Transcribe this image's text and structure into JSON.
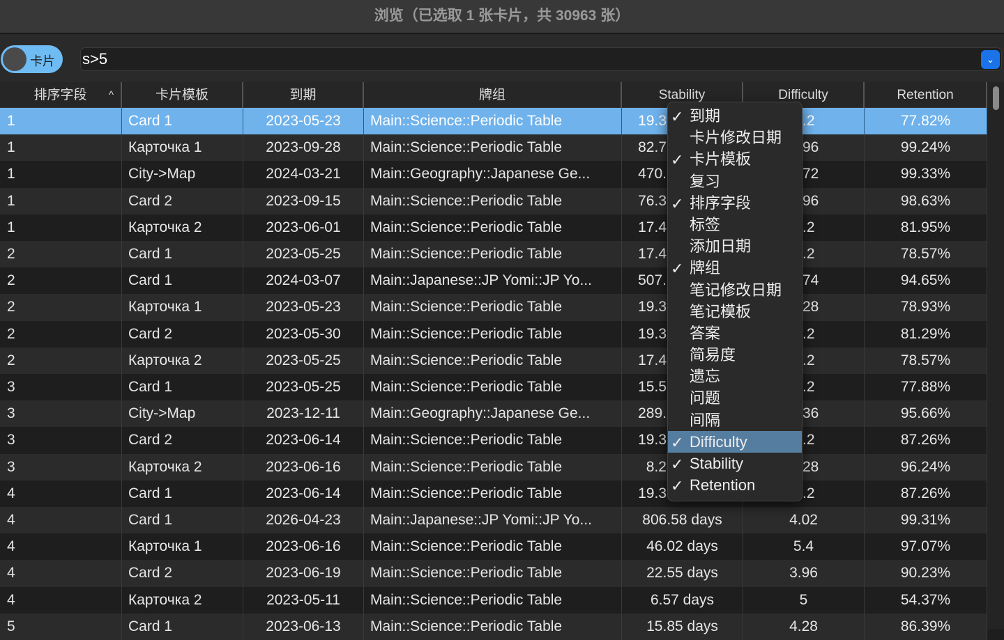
{
  "title": "浏览（已选取 1 张卡片，共 30963 张）",
  "toggle_label": "卡片",
  "search": {
    "value": "s>5"
  },
  "columns": [
    "排序字段",
    "卡片模板",
    "到期",
    "牌组",
    "Stability",
    "Difficulty",
    "Retention"
  ],
  "rows": [
    [
      "1",
      "Card 1",
      "2023-05-23",
      "Main::Science::Periodic Table",
      "19.3",
      ".2",
      "77.82%"
    ],
    [
      "1",
      "Карточка 1",
      "2023-09-28",
      "Main::Science::Periodic Table",
      "82.7",
      "96",
      "99.24%"
    ],
    [
      "1",
      "City->Map",
      "2024-03-21",
      "Main::Geography::Japanese Ge...",
      "470.",
      "72",
      "99.33%"
    ],
    [
      "1",
      "Card 2",
      "2023-09-15",
      "Main::Science::Periodic Table",
      "76.3",
      "96",
      "98.63%"
    ],
    [
      "1",
      "Карточка 2",
      "2023-06-01",
      "Main::Science::Periodic Table",
      "17.4",
      ".2",
      "81.95%"
    ],
    [
      "2",
      "Card 1",
      "2023-05-25",
      "Main::Science::Periodic Table",
      "17.4",
      ".2",
      "78.57%"
    ],
    [
      "2",
      "Card 1",
      "2024-03-07",
      "Main::Japanese::JP Yomi::JP Yo...",
      "507.",
      "74",
      "94.65%"
    ],
    [
      "2",
      "Карточка 1",
      "2023-05-23",
      "Main::Science::Periodic Table",
      "19.3",
      "28",
      "78.93%"
    ],
    [
      "2",
      "Card 2",
      "2023-05-30",
      "Main::Science::Periodic Table",
      "19.3",
      ".2",
      "81.29%"
    ],
    [
      "2",
      "Карточка 2",
      "2023-05-25",
      "Main::Science::Periodic Table",
      "17.4",
      ".2",
      "78.57%"
    ],
    [
      "3",
      "Card 1",
      "2023-05-25",
      "Main::Science::Periodic Table",
      "15.5",
      ".2",
      "77.88%"
    ],
    [
      "3",
      "City->Map",
      "2023-12-11",
      "Main::Geography::Japanese Ge...",
      "289.",
      "36",
      "95.66%"
    ],
    [
      "3",
      "Card 2",
      "2023-06-14",
      "Main::Science::Periodic Table",
      "19.3",
      ".2",
      "87.26%"
    ],
    [
      "3",
      "Карточка 2",
      "2023-06-16",
      "Main::Science::Periodic Table",
      "8.2",
      "28",
      "96.24%"
    ],
    [
      "4",
      "Card 1",
      "2023-06-14",
      "Main::Science::Periodic Table",
      "19.3",
      ".2",
      "87.26%"
    ],
    [
      "4",
      "Card 1",
      "2026-04-23",
      "Main::Japanese::JP Yomi::JP Yo...",
      "806.58 days",
      "4.02",
      "99.31%"
    ],
    [
      "4",
      "Карточка 1",
      "2023-06-16",
      "Main::Science::Periodic Table",
      "46.02 days",
      "5.4",
      "97.07%"
    ],
    [
      "4",
      "Card 2",
      "2023-06-19",
      "Main::Science::Periodic Table",
      "22.55 days",
      "3.96",
      "90.23%"
    ],
    [
      "4",
      "Карточка 2",
      "2023-05-11",
      "Main::Science::Periodic Table",
      "6.57 days",
      "5",
      "54.37%"
    ],
    [
      "5",
      "Card 1",
      "2023-06-13",
      "Main::Science::Periodic Table",
      "15.85 days",
      "4.28",
      "86.39%"
    ]
  ],
  "menu": [
    {
      "label": "到期",
      "checked": true
    },
    {
      "label": "卡片修改日期",
      "checked": false
    },
    {
      "label": "卡片模板",
      "checked": true
    },
    {
      "label": "复习",
      "checked": false
    },
    {
      "label": "排序字段",
      "checked": true
    },
    {
      "label": "标签",
      "checked": false
    },
    {
      "label": "添加日期",
      "checked": false
    },
    {
      "label": "牌组",
      "checked": true
    },
    {
      "label": "笔记修改日期",
      "checked": false
    },
    {
      "label": "笔记模板",
      "checked": false
    },
    {
      "label": "答案",
      "checked": false
    },
    {
      "label": "简易度",
      "checked": false
    },
    {
      "label": "遗忘",
      "checked": false
    },
    {
      "label": "问题",
      "checked": false
    },
    {
      "label": "间隔",
      "checked": false
    },
    {
      "label": "Difficulty",
      "checked": true,
      "highlighted": true
    },
    {
      "label": "Stability",
      "checked": true
    },
    {
      "label": "Retention",
      "checked": true
    }
  ],
  "check_glyph": "✓",
  "sort_glyph": "^",
  "dropdown_glyph": "⌄"
}
